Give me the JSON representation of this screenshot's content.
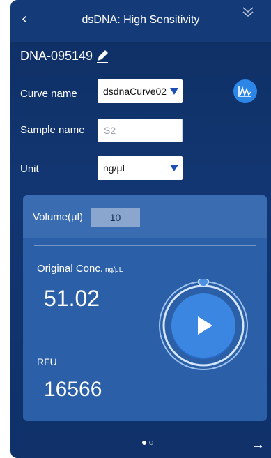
{
  "header": {
    "title": "dsDNA: High Sensitivity",
    "back_icon": "back-chevron-icon",
    "collapse_icon": "double-chevron-down-icon"
  },
  "sample": {
    "id": "DNA-095149",
    "edit_icon": "pencil-icon"
  },
  "form": {
    "curve_label": "Curve name",
    "curve_value": "dsdnaCurve02",
    "sample_label": "Sample name",
    "sample_placeholder": "S2",
    "unit_label": "Unit",
    "unit_value": "ng/μL",
    "curve_icon": "curve-chart-icon"
  },
  "measurement": {
    "volume_label": "Volume(μl)",
    "volume_value": "10",
    "orig_label": "Original Conc.",
    "orig_unit": "ng/μL",
    "orig_value": "51.02",
    "rfu_label": "RFU",
    "rfu_value": "16566",
    "play_icon": "play-icon"
  },
  "footer": {
    "pager_total": 2,
    "pager_active": 1,
    "next_icon": "arrow-right-icon"
  },
  "colors": {
    "accent": "#2b86e8",
    "background": "#123672",
    "card": "#2b5fa7"
  }
}
